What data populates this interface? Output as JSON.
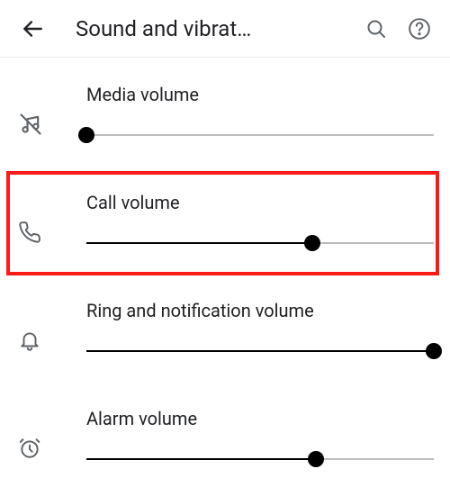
{
  "appbar": {
    "title": "Sound and vibrat…"
  },
  "rows": {
    "media": {
      "label": "Media volume",
      "value": 0
    },
    "call": {
      "label": "Call volume",
      "value": 65
    },
    "ring": {
      "label": "Ring and notification volume",
      "value": 100
    },
    "alarm": {
      "label": "Alarm volume",
      "value": 66
    }
  },
  "icons": {
    "back": "back-arrow",
    "search": "search-icon",
    "help": "help-icon",
    "media_mute": "music-off-icon",
    "call": "phone-icon",
    "ring": "bell-icon",
    "alarm": "alarm-clock-icon"
  }
}
